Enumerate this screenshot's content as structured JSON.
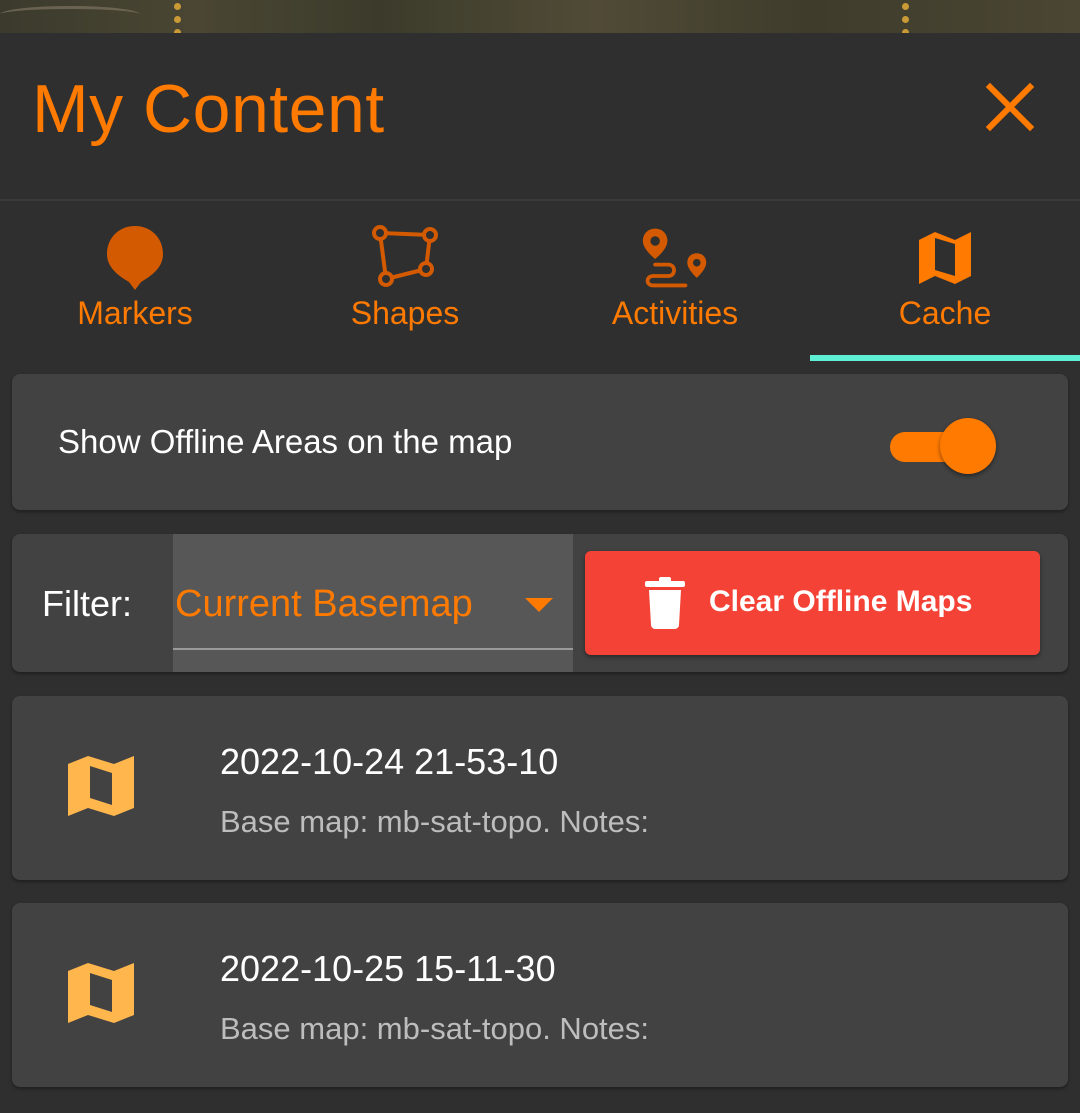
{
  "colors": {
    "accent": "#ff7a00",
    "tab_indicator": "#5ef0d5",
    "danger": "#f44336",
    "map_icon": "#ffb74d",
    "surface": "#424242",
    "background": "#2f2f2f"
  },
  "header": {
    "title": "My Content",
    "close_icon": "close-icon"
  },
  "tabs": [
    {
      "label": "Markers",
      "icon": "map-pin-icon",
      "active": false
    },
    {
      "label": "Shapes",
      "icon": "polyline-icon",
      "active": false
    },
    {
      "label": "Activities",
      "icon": "route-icon",
      "active": false
    },
    {
      "label": "Cache",
      "icon": "map-icon",
      "active": true
    }
  ],
  "offline_toggle": {
    "label": "Show Offline Areas on the map",
    "checked": true
  },
  "filter": {
    "label": "Filter:",
    "selected": "Current Basemap",
    "clear_button_label": "Clear Offline Maps",
    "clear_button_icon": "trash-icon"
  },
  "offline_maps": [
    {
      "title": "2022-10-24 21-53-10",
      "subtitle": "Base map: mb-sat-topo. Notes:",
      "icon": "map-icon"
    },
    {
      "title": "2022-10-25 15-11-30",
      "subtitle": "Base map: mb-sat-topo. Notes:",
      "icon": "map-icon"
    }
  ]
}
